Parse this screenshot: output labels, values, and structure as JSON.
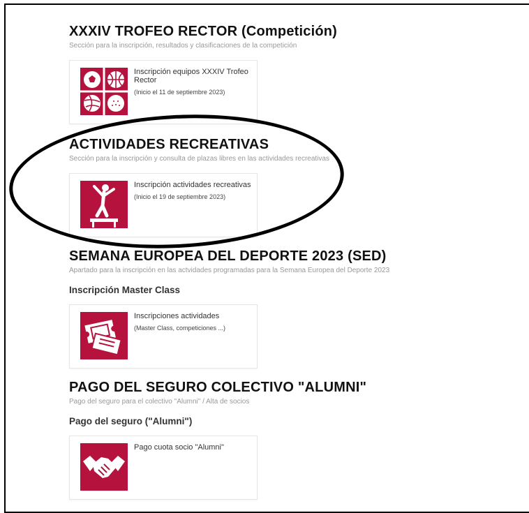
{
  "sections": [
    {
      "title": "XXXIV TROFEO RECTOR (Competición)",
      "subtitle": "Sección para la inscripción, resultados y clasificaciones de la competición",
      "card": {
        "line1": "Inscripción equipos XXXIV Trofeo Rector",
        "line2": "(Inicio el 11 de septiembre 2023)",
        "icon": "sports-balls-icon"
      }
    },
    {
      "title": "ACTIVIDADES RECREATIVAS",
      "subtitle": "Sección para la inscripción y consulta de plazas libres en las actividades recreativas",
      "card": {
        "line1": "Inscripción actividades recreativas",
        "line2": "(Inicio el 19 de septiembre 2023)",
        "icon": "gymnast-icon"
      }
    },
    {
      "title": "SEMANA EUROPEA DEL DEPORTE 2023 (SED)",
      "subtitle": "Apartado para la inscripción en las actvidades programadas para la Semana Europea del Deporte 2023",
      "subheading": "Inscripción Master Class",
      "card": {
        "line1": "Inscripciones actividades",
        "line2": "(Master Class, competiciones ...)",
        "icon": "tickets-icon"
      }
    },
    {
      "title": "PAGO DEL SEGURO COLECTIVO \"ALUMNI\"",
      "subtitle": "Pago del seguro para el colectivo \"Alumni\" / Alta de socios",
      "subheading": "Pago del seguro (\"Alumni\")",
      "card": {
        "line1": "Pago cuota socio \"Alumni\"",
        "line2": "",
        "icon": "handshake-icon"
      }
    }
  ],
  "colors": {
    "accent": "#b5123e",
    "subtitle": "#999999",
    "border": "#e6e6e6"
  }
}
